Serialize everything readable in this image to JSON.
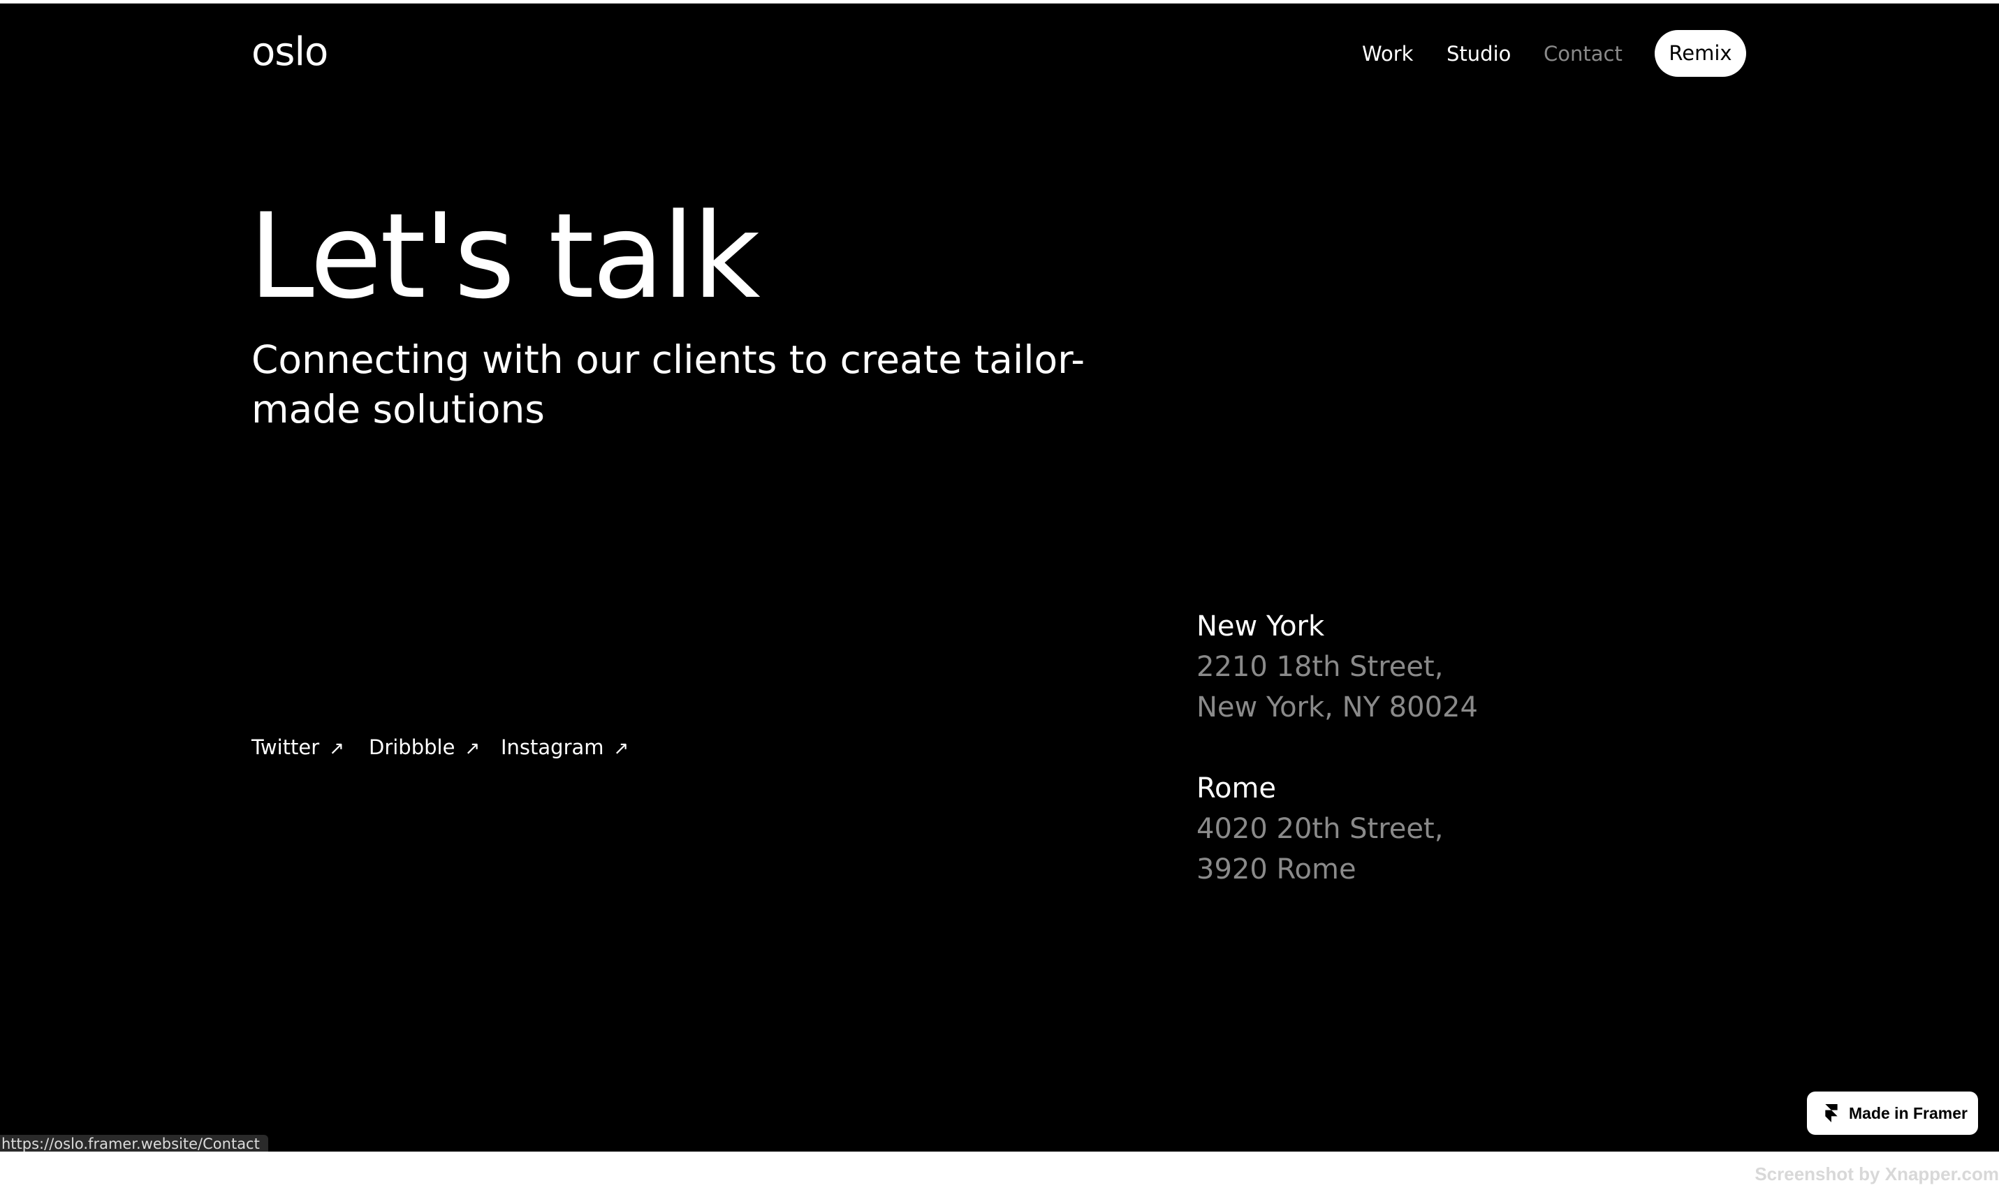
{
  "header": {
    "logo": "oslo",
    "nav": [
      {
        "label": "Work",
        "active": false
      },
      {
        "label": "Studio",
        "active": false
      },
      {
        "label": "Contact",
        "active": true
      }
    ],
    "cta_label": "Remix"
  },
  "hero": {
    "title": "Let's talk",
    "subtitle": "Connecting with our clients to create tailor-made solutions"
  },
  "socials": [
    {
      "label": "Twitter",
      "icon": "arrow-up-right-icon"
    },
    {
      "label": "Dribbble",
      "icon": "arrow-up-right-icon"
    },
    {
      "label": "Instagram",
      "icon": "arrow-up-right-icon"
    }
  ],
  "offices": [
    {
      "city": "New York",
      "lines": [
        "2210 18th Street,",
        "New York, NY 80024"
      ]
    },
    {
      "city": "Rome",
      "lines": [
        "4020 20th Street,",
        "3920 Rome"
      ]
    }
  ],
  "framer_badge": {
    "label": "Made in Framer",
    "icon": "framer-logo-icon"
  },
  "status_bar": {
    "url": "https://oslo.framer.website/Contact"
  },
  "watermark": "Screenshot by Xnapper.com",
  "colors": {
    "background": "#000000",
    "text": "#ffffff",
    "muted": "#8a8a8a"
  }
}
